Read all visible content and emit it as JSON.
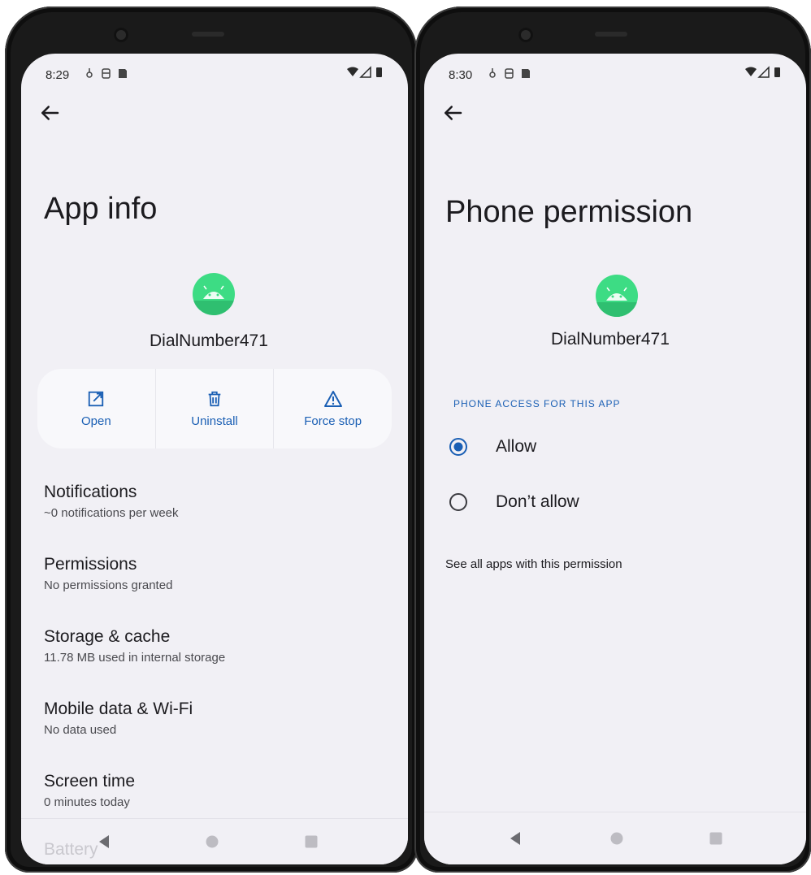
{
  "left_screen": {
    "status": {
      "time": "8:29"
    },
    "title": "App info",
    "app_name": "DialNumber471",
    "actions": [
      {
        "label": "Open",
        "icon": "open-external-icon"
      },
      {
        "label": "Uninstall",
        "icon": "trash-icon"
      },
      {
        "label": "Force stop",
        "icon": "warning-icon"
      }
    ],
    "settings": [
      {
        "title": "Notifications",
        "subtitle": "~0 notifications per week"
      },
      {
        "title": "Permissions",
        "subtitle": "No permissions granted"
      },
      {
        "title": "Storage & cache",
        "subtitle": "11.78 MB used in internal storage"
      },
      {
        "title": "Mobile data & Wi-Fi",
        "subtitle": "No data used"
      },
      {
        "title": "Screen time",
        "subtitle": "0 minutes today"
      }
    ],
    "partial_item": "Battery"
  },
  "right_screen": {
    "status": {
      "time": "8:30"
    },
    "title": "Phone permission",
    "app_name": "DialNumber471",
    "section_label": "PHONE ACCESS FOR THIS APP",
    "options": [
      {
        "label": "Allow",
        "selected": true
      },
      {
        "label": "Don’t allow",
        "selected": false
      }
    ],
    "see_all": "See all apps with this permission"
  },
  "colors": {
    "accent": "#1a5fb4",
    "screen_bg": "#f1f0f5",
    "android_green": "#3ddc84"
  }
}
